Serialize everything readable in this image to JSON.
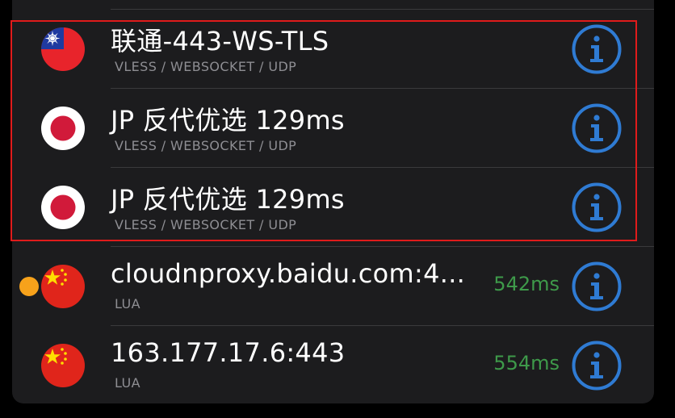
{
  "colors": {
    "panel_bg": "#1c1c1e",
    "title": "#ffffff",
    "subtitle": "#8e8e93",
    "latency": "#3e9a4a",
    "info_icon": "#2f7bd3",
    "highlight_border": "#e01b1b",
    "status_dot": "#f7a21b"
  },
  "servers": [
    {
      "title": "联通-443-WS-TLS",
      "subtitle": "VLESS / WEBSOCKET / UDP",
      "latency": "",
      "flag": "taiwan-flag-icon"
    },
    {
      "title": "JP 反代优选 129ms",
      "subtitle": "VLESS / WEBSOCKET / UDP",
      "latency": "",
      "flag": "japan-flag-icon"
    },
    {
      "title": "JP 反代优选 129ms",
      "subtitle": "VLESS / WEBSOCKET / UDP",
      "latency": "",
      "flag": "japan-flag-icon"
    },
    {
      "title": "cloudnproxy.baidu.com:4...",
      "subtitle": "LUA",
      "latency": "542ms",
      "flag": "china-flag-icon",
      "status_dot": "active-status-dot"
    },
    {
      "title": "163.177.17.6:443",
      "subtitle": "LUA",
      "latency": "554ms",
      "flag": "china-flag-icon"
    }
  ]
}
